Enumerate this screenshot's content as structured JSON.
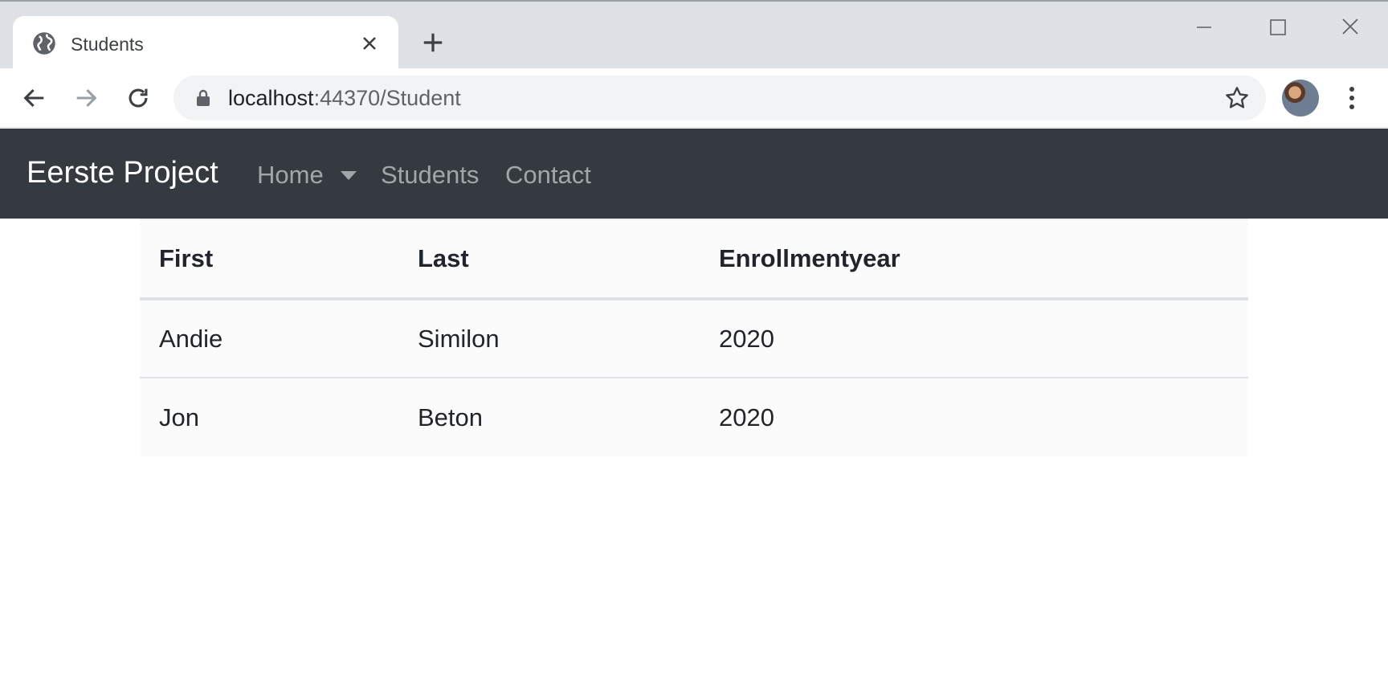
{
  "browser": {
    "tab_title": "Students",
    "url_host": "localhost",
    "url_rest": ":44370/Student"
  },
  "navbar": {
    "brand": "Eerste Project",
    "links": [
      "Home",
      "Students",
      "Contact"
    ]
  },
  "table": {
    "headers": [
      "First",
      "Last",
      "Enrollmentyear"
    ],
    "rows": [
      [
        "Andie",
        "Similon",
        "2020"
      ],
      [
        "Jon",
        "Beton",
        "2020"
      ]
    ]
  },
  "colors": {
    "navbar_bg": "#343a40",
    "tabstrip_bg": "#dee1e6",
    "omnibox_bg": "#f1f3f4"
  },
  "icons": [
    "globe-icon",
    "close-icon",
    "plus-icon",
    "minimize-icon",
    "maximize-icon",
    "window-close-icon",
    "back-arrow-icon",
    "forward-arrow-icon",
    "reload-icon",
    "lock-icon",
    "star-icon",
    "kebab-menu-icon",
    "caret-down-icon"
  ]
}
